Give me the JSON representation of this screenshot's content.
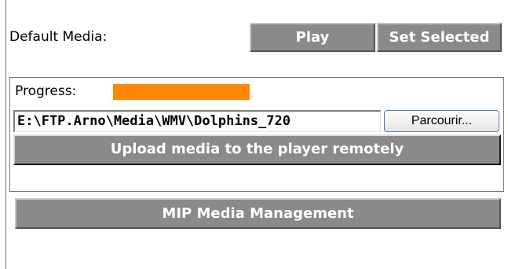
{
  "default_media": {
    "label": "Default Media:",
    "play_label": "Play",
    "set_selected_label": "Set Selected"
  },
  "upload": {
    "progress_label": "Progress:",
    "progress_value": 1.0,
    "progress_color": "#ff8800",
    "file_path": "E:\\FTP.Arno\\Media\\WMV\\Dolphins_720",
    "browse_label": "Parcourir...",
    "upload_label": "Upload media to the player remotely"
  },
  "management": {
    "mip_label": "MIP Media Management"
  },
  "colors": {
    "button_gray": "#8a8a8a",
    "button_text": "#ffffff"
  }
}
